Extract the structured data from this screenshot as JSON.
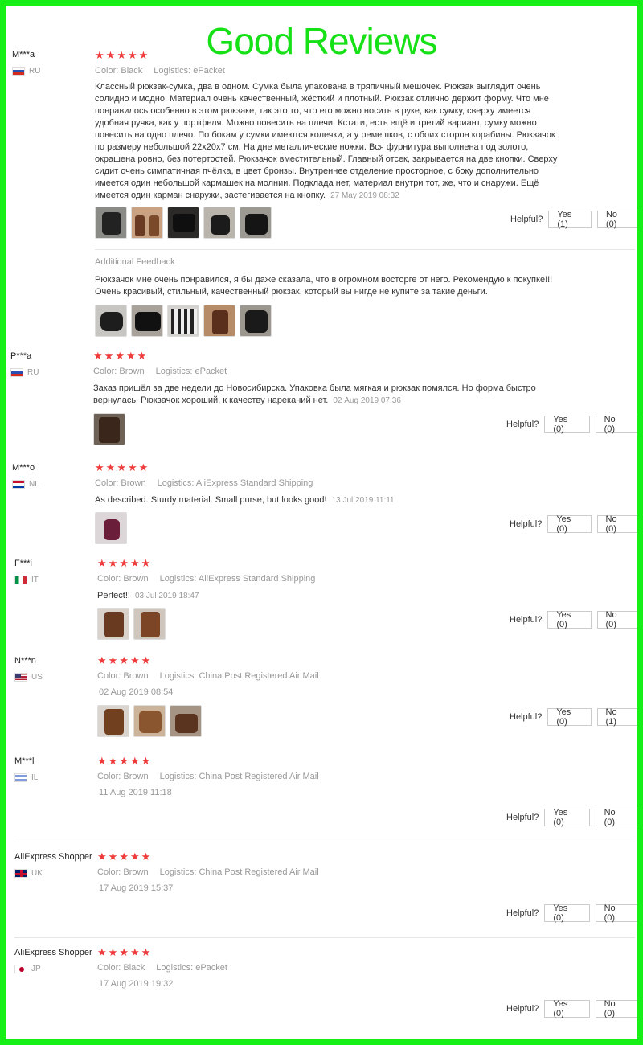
{
  "page_title": "Good Reviews",
  "helpful_label": "Helpful?",
  "reviews": [
    {
      "user": "M***a",
      "country": "RU",
      "stars": 5,
      "color": "Color: Black",
      "logistics": "Logistics: ePacket",
      "text": "Классный рюкзак-сумка, два в одном. Сумка была упакована в тряпичный мешочек. Рюкзак выглядит очень солидно и модно. Материал очень качественный, жёсткий и плотный. Рюкзак отлично держит форму. Что мне понравилось особенно в этом рюкзаке, так это то, что его можно носить в руке, как сумку, сверху имеется удобная ручка, как у портфеля. Можно повесить на плечи. Кстати, есть ещё и третий вариант, сумку можно повесить на одно плечо. По бокам у сумки имеются колечки, а у ремешков, с обоих сторон корабины. Рюкзачок по размеру небольшой 22х20х7 см. На дне металлические ножки. Вся фурнитура выполнена под золото, окрашена ровно, без потертостей. Рюкзачок вместительный. Главный отсек, закрывается на две кнопки. Сверху сидит очень симпатичная пчёлка, в цвет бронзы. Внутреннее отделение просторное, с боку дополнительно имеется один небольшой кармашек на молнии. Подклада нет, материал внутри тот, же, что и снаружи. Ещё имеется один карман снаружи, застегивается на кнопку.",
      "date": "27 May 2019 08:32",
      "yes": "Yes (1)",
      "no": "No (0)",
      "additional_label": "Additional Feedback",
      "additional_text": "Рюкзачок мне очень понравился, я бы даже сказала, что в огромном восторге от него. Рекомендую к покупке!!! Очень красивый, стильный, качественный рюкзак, который вы нигде не купите за такие деньги."
    },
    {
      "user": "P***a",
      "country": "RU",
      "stars": 5,
      "color": "Color: Brown",
      "logistics": "Logistics: ePacket",
      "text": "Заказ пришёл за две недели до Новосибирска. Упаковка была мягкая и рюкзак помялся. Но форма быстро вернулась. Рюкзачок хороший, к качеству нареканий нет.",
      "date": "02 Aug 2019 07:36",
      "yes": "Yes (0)",
      "no": "No (0)"
    },
    {
      "user": "M***o",
      "country": "NL",
      "stars": 5,
      "color": "Color: Brown",
      "logistics": "Logistics: AliExpress Standard Shipping",
      "text": "As described. Sturdy material. Small purse, but looks good!",
      "date": "13 Jul 2019 11:11",
      "yes": "Yes (0)",
      "no": "No (0)"
    },
    {
      "user": "F***i",
      "country": "IT",
      "stars": 5,
      "color": "Color: Brown",
      "logistics": "Logistics: AliExpress Standard Shipping",
      "text": "Perfect!!",
      "date": "03 Jul 2019 18:47",
      "yes": "Yes (0)",
      "no": "No (0)"
    },
    {
      "user": "N***n",
      "country": "US",
      "stars": 5,
      "color": "Color: Brown",
      "logistics": "Logistics: China Post Registered Air Mail",
      "text": "",
      "date": "02 Aug 2019 08:54",
      "yes": "Yes (0)",
      "no": "No (1)"
    },
    {
      "user": "M***l",
      "country": "IL",
      "stars": 5,
      "color": "Color: Brown",
      "logistics": "Logistics: China Post Registered Air Mail",
      "text": "",
      "date": "11 Aug 2019 11:18",
      "yes": "Yes (0)",
      "no": "No (0)"
    },
    {
      "user": "AliExpress Shopper",
      "country": "UK",
      "stars": 5,
      "color": "Color: Brown",
      "logistics": "Logistics: China Post Registered Air Mail",
      "text": "",
      "date": "17 Aug 2019 15:37",
      "yes": "Yes (0)",
      "no": "No (0)"
    },
    {
      "user": "AliExpress Shopper",
      "country": "JP",
      "stars": 5,
      "color": "Color: Black",
      "logistics": "Logistics: ePacket",
      "text": "",
      "date": "17 Aug 2019 19:32",
      "yes": "Yes (0)",
      "no": "No (0)"
    }
  ],
  "colors": {
    "frame": "#16f016",
    "title": "#16e016",
    "star": "#ef3b3b"
  }
}
